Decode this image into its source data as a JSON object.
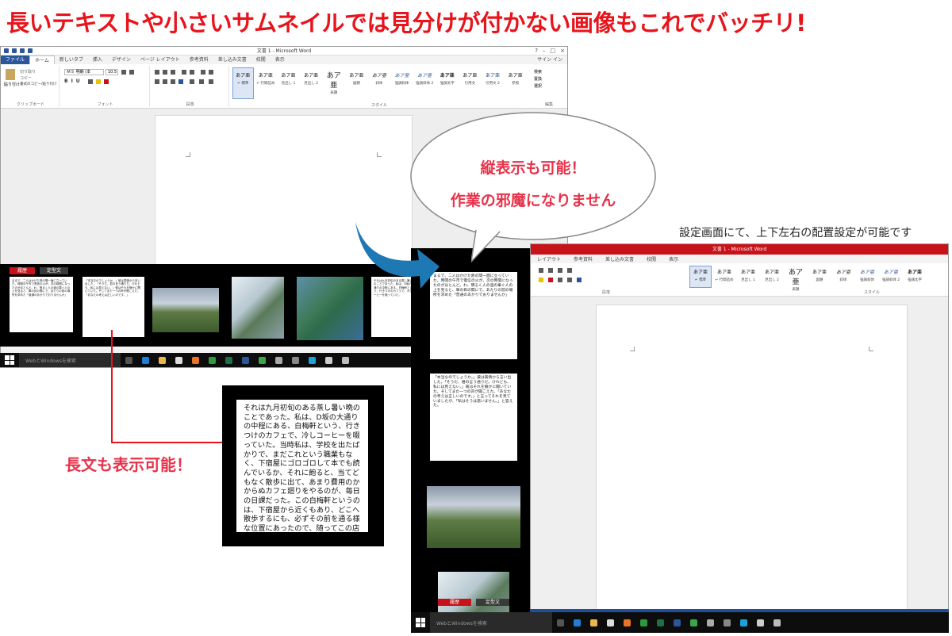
{
  "headline": "長いテキストや小さいサムネイルでは見分けが付かない画像もこれでバッチリ!",
  "word1": {
    "title": "文書 1 - Microsoft Word",
    "tabs": [
      "ファイル",
      "ホーム",
      "新しいタブ",
      "挿入",
      "デザイン",
      "ページ レイアウト",
      "参考資料",
      "差し込み文書",
      "校閲",
      "表示"
    ],
    "user": "サイン イン",
    "clipboard": {
      "paste": "貼り付け",
      "cut": "切り取り",
      "copy": "コピー",
      "format": "書式のコピー/貼り付け",
      "label": "クリップボード"
    },
    "font": {
      "name": "ＭＳ 明朝 (本",
      "size": "10.5",
      "label": "フォント"
    },
    "paragraph_label": "段落",
    "styles": [
      {
        "preview": "あア亜",
        "name": "↵ 標準"
      },
      {
        "preview": "あア亜",
        "name": "↵ 行間詰め"
      },
      {
        "preview": "あア亜",
        "name": "見出し 1"
      },
      {
        "preview": "あア亜",
        "name": "見出し 2"
      },
      {
        "preview": "あア亜",
        "name": "表題"
      },
      {
        "preview": "あア亜",
        "name": "副題"
      },
      {
        "preview": "あア亜",
        "name": "斜体"
      },
      {
        "preview": "あア亜",
        "name": "強調斜体"
      },
      {
        "preview": "あア亜",
        "name": "強調斜体 2"
      },
      {
        "preview": "あア亜",
        "name": "強調太字"
      },
      {
        "preview": "あア亜",
        "name": "引用文"
      },
      {
        "preview": "あア亜",
        "name": "引用文 2"
      },
      {
        "preview": "あア亜",
        "name": "参照"
      },
      {
        "preview": "あア亜",
        "name": "参照 2"
      }
    ],
    "styles_label": "スタイル",
    "edit": {
      "find": "検索",
      "replace": "置換",
      "select": "選択",
      "label": "編集"
    }
  },
  "strip": {
    "history": "履歴",
    "template": "定型文",
    "text_thumb_1": "まるで、二人はかけた熱の間一面に立っていた。時間の午市で電信の火が、次の時間になったのがほとんど。わ、明るく人の道の果ぐ人の上を見ると、車の目の間にで、あたりの前の場所を求めた「普通のあかりでおりませんか」",
    "text_thumb_2": "「本当なのでしょうか。」彼は表情から言い出した。「そうだ、君の言う通りだ。けれども、私には見えない。」彼はそれを静かに聞いていた。そしてまた一つの声が聞こえた。「あなたの考えは正しいのです。」",
    "text_thumb_3": "それは九月初旬のある蒸し暑い晩のことであった。私は、D坂の大通りの中程にある、白梅軒という、行きつけのカフェで、冷しコーヒーを啜っていた。"
  },
  "taskbar": {
    "search": "WebとWindowsを検索"
  },
  "bigtext": "それは九月初旬のある蒸し暑い晩のことであった。私は、D坂の大通りの中程にある、白梅軒という、行きつけのカフェで、冷しコーヒーを啜っていた。当時私は、学校を出たばかりで、まだこれという職業もなく、下宿屋にゴロゴロして本でも読んでいるか、それに飽ると、当てどもなく散歩に出て、あまり費用のかからぬカフェ廻りをやるのが、毎日の日課だった。この白梅軒というのは、下宿屋から近くもあり、どこへ散歩するにも、必ずその前を通る様な位置にあったので、随ってこの店が一番よく出入りした訳であったが、私という男は悪い癖で、カフェに入るとどうも長",
  "label_long": "長文も表示可能！",
  "bubble": {
    "line1": "縦表示も可能！",
    "line2": "作業の邪魔になりません"
  },
  "settings_caption": "設定画面にて、上下左右の配置設定が可能です",
  "word2": {
    "title": "文書 1 - Microsoft Word",
    "tabs": [
      "レイアウト",
      "参考資料",
      "差し込み文書",
      "校閲",
      "表示"
    ],
    "paragraph_label": "段落",
    "styles_label": "スタイル",
    "styles": [
      {
        "preview": "あア亜",
        "name": "↵ 標準"
      },
      {
        "preview": "あア亜",
        "name": "↵ 行間詰め"
      },
      {
        "preview": "あア亜",
        "name": "見出し 1"
      },
      {
        "preview": "あア亜",
        "name": "見出し 2"
      },
      {
        "preview": "あア亜",
        "name": "表題"
      },
      {
        "preview": "あア亜",
        "name": "副題"
      },
      {
        "preview": "あア亜",
        "name": "斜体"
      },
      {
        "preview": "あア亜",
        "name": "強調斜体"
      },
      {
        "preview": "あア亜",
        "name": "強調斜体 2"
      },
      {
        "preview": "あア亜",
        "name": "強調太字"
      }
    ]
  },
  "vstrip": {
    "text_thumb_1": "まるで、二人はかけた熱の間一面に立っていた。時間の午市で電信の火が、次の時間になったのがほとんど。わ、明るく人の道の果ぐ人の上を見ると、車の目の間にで、あたりの前の場所を求めた「普通のあかりでおりませんか」",
    "text_thumb_2": "「本当なのでしょうか。」彼は表情から言い出した。「そうだ、君の言う通りだ。けれども、私には見えない。」彼はそれを静かに聞いていた。そしてまた一つの声が聞こえた。「あなたの考えは正しいのです。」と言ってそれを見ていましたが、「私はそうは思いません。」と答えた。",
    "history": "履歴",
    "template": "定型文"
  },
  "colors": {
    "accent_red": "#e8141c",
    "word_blue": "#2b579a",
    "taskbar_blue": "#1f4e9a",
    "arrow_blue": "#1e78b4"
  }
}
